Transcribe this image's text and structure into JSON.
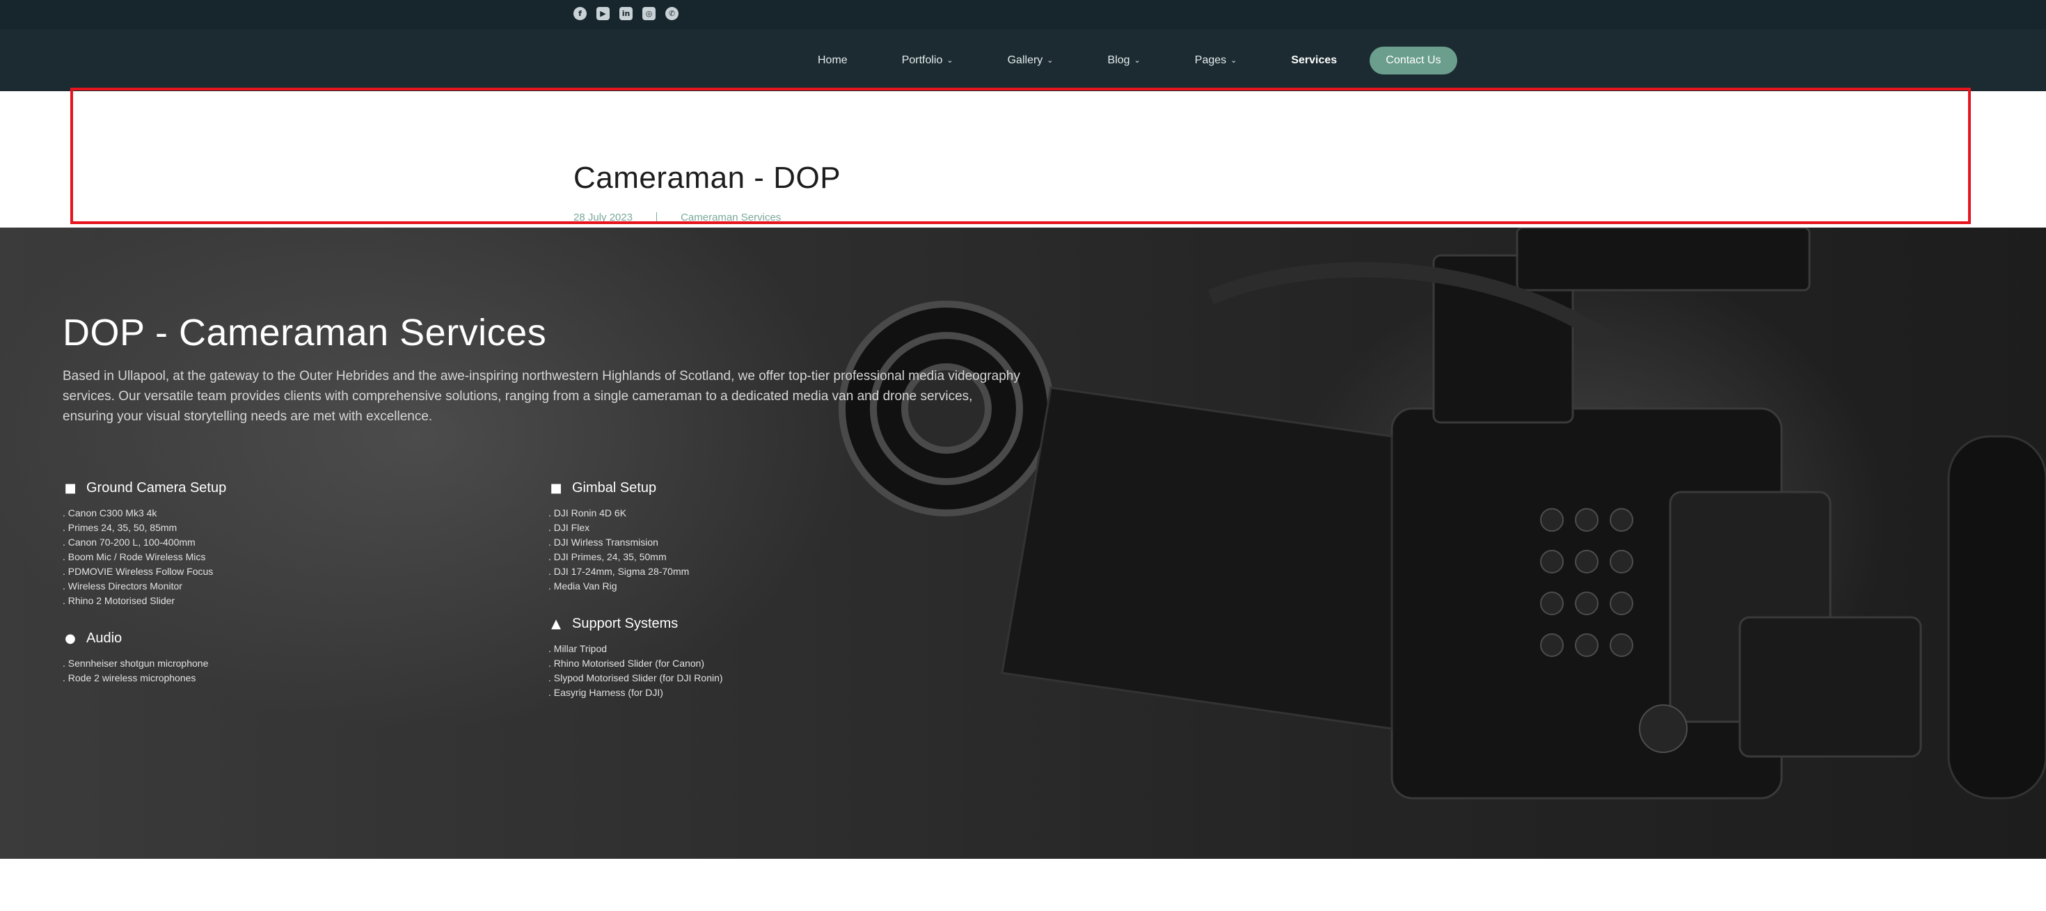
{
  "social": [
    {
      "icon": "facebook-icon",
      "glyph": "f"
    },
    {
      "icon": "youtube-icon",
      "glyph": "▶"
    },
    {
      "icon": "linkedin-icon",
      "glyph": "in"
    },
    {
      "icon": "instagram-icon",
      "glyph": "◎"
    },
    {
      "icon": "whatsapp-icon",
      "glyph": "✆"
    }
  ],
  "nav": {
    "items": [
      {
        "label": "Home",
        "has_dropdown": false
      },
      {
        "label": "Portfolio",
        "has_dropdown": true
      },
      {
        "label": "Gallery",
        "has_dropdown": true
      },
      {
        "label": "Blog",
        "has_dropdown": true
      },
      {
        "label": "Pages",
        "has_dropdown": true
      },
      {
        "label": "Services",
        "has_dropdown": false,
        "active": true
      }
    ],
    "chevron": "⌄",
    "contact_label": "Contact Us"
  },
  "post": {
    "title": "Cameraman - DOP",
    "date": "28 July 2023",
    "category": "Cameraman Services"
  },
  "hero": {
    "title": "DOP - Cameraman Services",
    "description": "Based in Ullapool, at the gateway to the Outer Hebrides and the awe-inspiring northwestern Highlands of Scotland, we offer top-tier professional media videography services. Our versatile team provides clients with comprehensive solutions, ranging from a single cameraman to a dedicated media van and drone services, ensuring your visual storytelling needs are met with excellence."
  },
  "equipment": {
    "ground": {
      "title": "Ground Camera Setup",
      "icon": "video-camera-icon",
      "items": [
        ". Canon C300 Mk3 4k",
        ". Primes 24, 35, 50, 85mm",
        ". Canon 70-200 L, 100-400mm",
        ". Boom Mic / Rode Wireless Mics",
        ". PDMOVIE Wireless Follow Focus",
        ". Wireless Directors Monitor",
        ". Rhino 2 Motorised Slider"
      ]
    },
    "audio": {
      "title": "Audio",
      "icon": "microphone-icon",
      "items": [
        ". Sennheiser shotgun microphone",
        ". Rode 2 wireless microphones"
      ]
    },
    "gimbal": {
      "title": "Gimbal Setup",
      "icon": "video-camera-icon",
      "items": [
        ". DJI Ronin 4D 6K",
        ". DJI Flex",
        ". DJI Wirless Transmision",
        ". DJI Primes, 24, 35, 50mm",
        ". DJI 17-24mm, Sigma 28-70mm",
        ". Media Van Rig"
      ]
    },
    "support": {
      "title": "Support Systems",
      "icon": "caret-up-icon",
      "items": [
        ". Millar Tripod",
        ". Rhino Motorised Slider (for Canon)",
        ". Slypod Motorised Slider (for DJI Ronin)",
        ". Easyrig Harness (for DJI)"
      ]
    }
  }
}
